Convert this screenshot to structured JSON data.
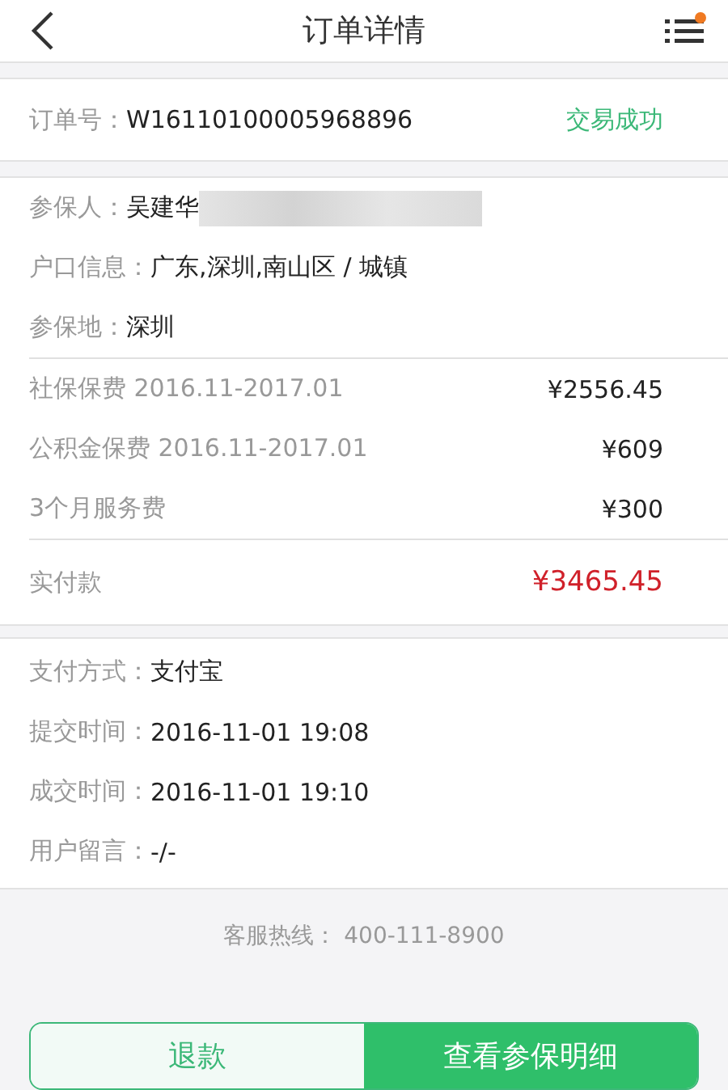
{
  "header": {
    "title": "订单详情",
    "has_notification": true
  },
  "order": {
    "label": "订单号：",
    "number": "W16110100005968896",
    "status": "交易成功"
  },
  "insured": [
    {
      "label": "参保人：",
      "value": "吴建华",
      "redacted": true
    },
    {
      "label": "户口信息：",
      "value": "广东,深圳,南山区 / 城镇",
      "redacted": false
    },
    {
      "label": "参保地：",
      "value": "深圳",
      "redacted": false
    }
  ],
  "fees": [
    {
      "name": "社保保费 2016.11-2017.01",
      "amount": "¥2556.45"
    },
    {
      "name": "公积金保费 2016.11-2017.01",
      "amount": "¥609"
    },
    {
      "name": "3个月服务费",
      "amount": "¥300"
    }
  ],
  "total": {
    "label": "实付款",
    "amount": "¥3465.45"
  },
  "payment": [
    {
      "label": "支付方式：",
      "value": "支付宝"
    },
    {
      "label": "提交时间：",
      "value": "2016-11-01 19:08"
    },
    {
      "label": "成交时间：",
      "value": "2016-11-01 19:10"
    },
    {
      "label": "用户留言：",
      "value": "-/-"
    }
  ],
  "hotline": {
    "label": "客服热线：",
    "number": "400-111-8900"
  },
  "buttons": [
    {
      "label": "退款",
      "kind": "outline"
    },
    {
      "label": "查看参保明细",
      "kind": "filled"
    }
  ]
}
